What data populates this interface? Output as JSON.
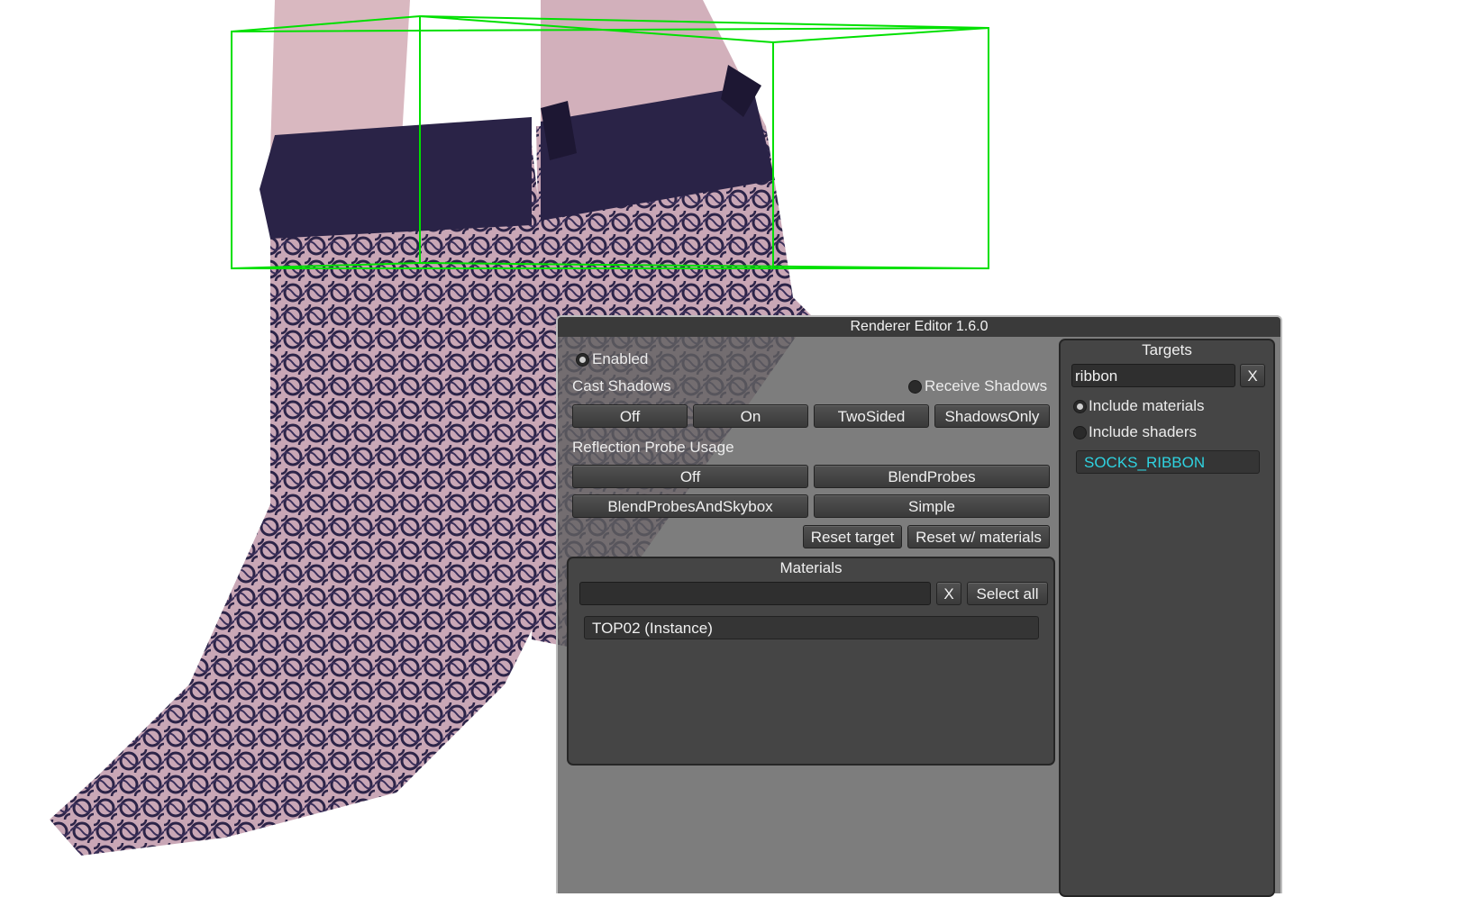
{
  "window": {
    "title": "Renderer Editor 1.6.0"
  },
  "renderer": {
    "enabled_label": "Enabled",
    "enabled": true,
    "cast_shadows_label": "Cast Shadows",
    "receive_shadows_label": "Receive Shadows",
    "receive_shadows": false,
    "cast_shadow_options": [
      "Off",
      "On",
      "TwoSided",
      "ShadowsOnly"
    ],
    "reflection_probe_label": "Reflection Probe Usage",
    "reflection_probe_options": [
      "Off",
      "BlendProbes",
      "BlendProbesAndSkybox",
      "Simple"
    ],
    "reset_target_label": "Reset target",
    "reset_materials_label": "Reset w/ materials"
  },
  "materials": {
    "title": "Materials",
    "search_value": "",
    "clear_label": "X",
    "select_all_label": "Select all",
    "items": [
      "TOP02 (Instance)"
    ]
  },
  "targets": {
    "title": "Targets",
    "search_value": "ribbon",
    "clear_label": "X",
    "include_materials_label": "Include materials",
    "include_materials": true,
    "include_shaders_label": "Include shaders",
    "include_shaders": false,
    "items": [
      "SOCKS_RIBBON"
    ],
    "selected_color": "#2fd2e0"
  },
  "scene": {
    "sock_color": "#2c2448",
    "skin_color": "#d9b8c0",
    "bounds_color": "#00e000"
  }
}
